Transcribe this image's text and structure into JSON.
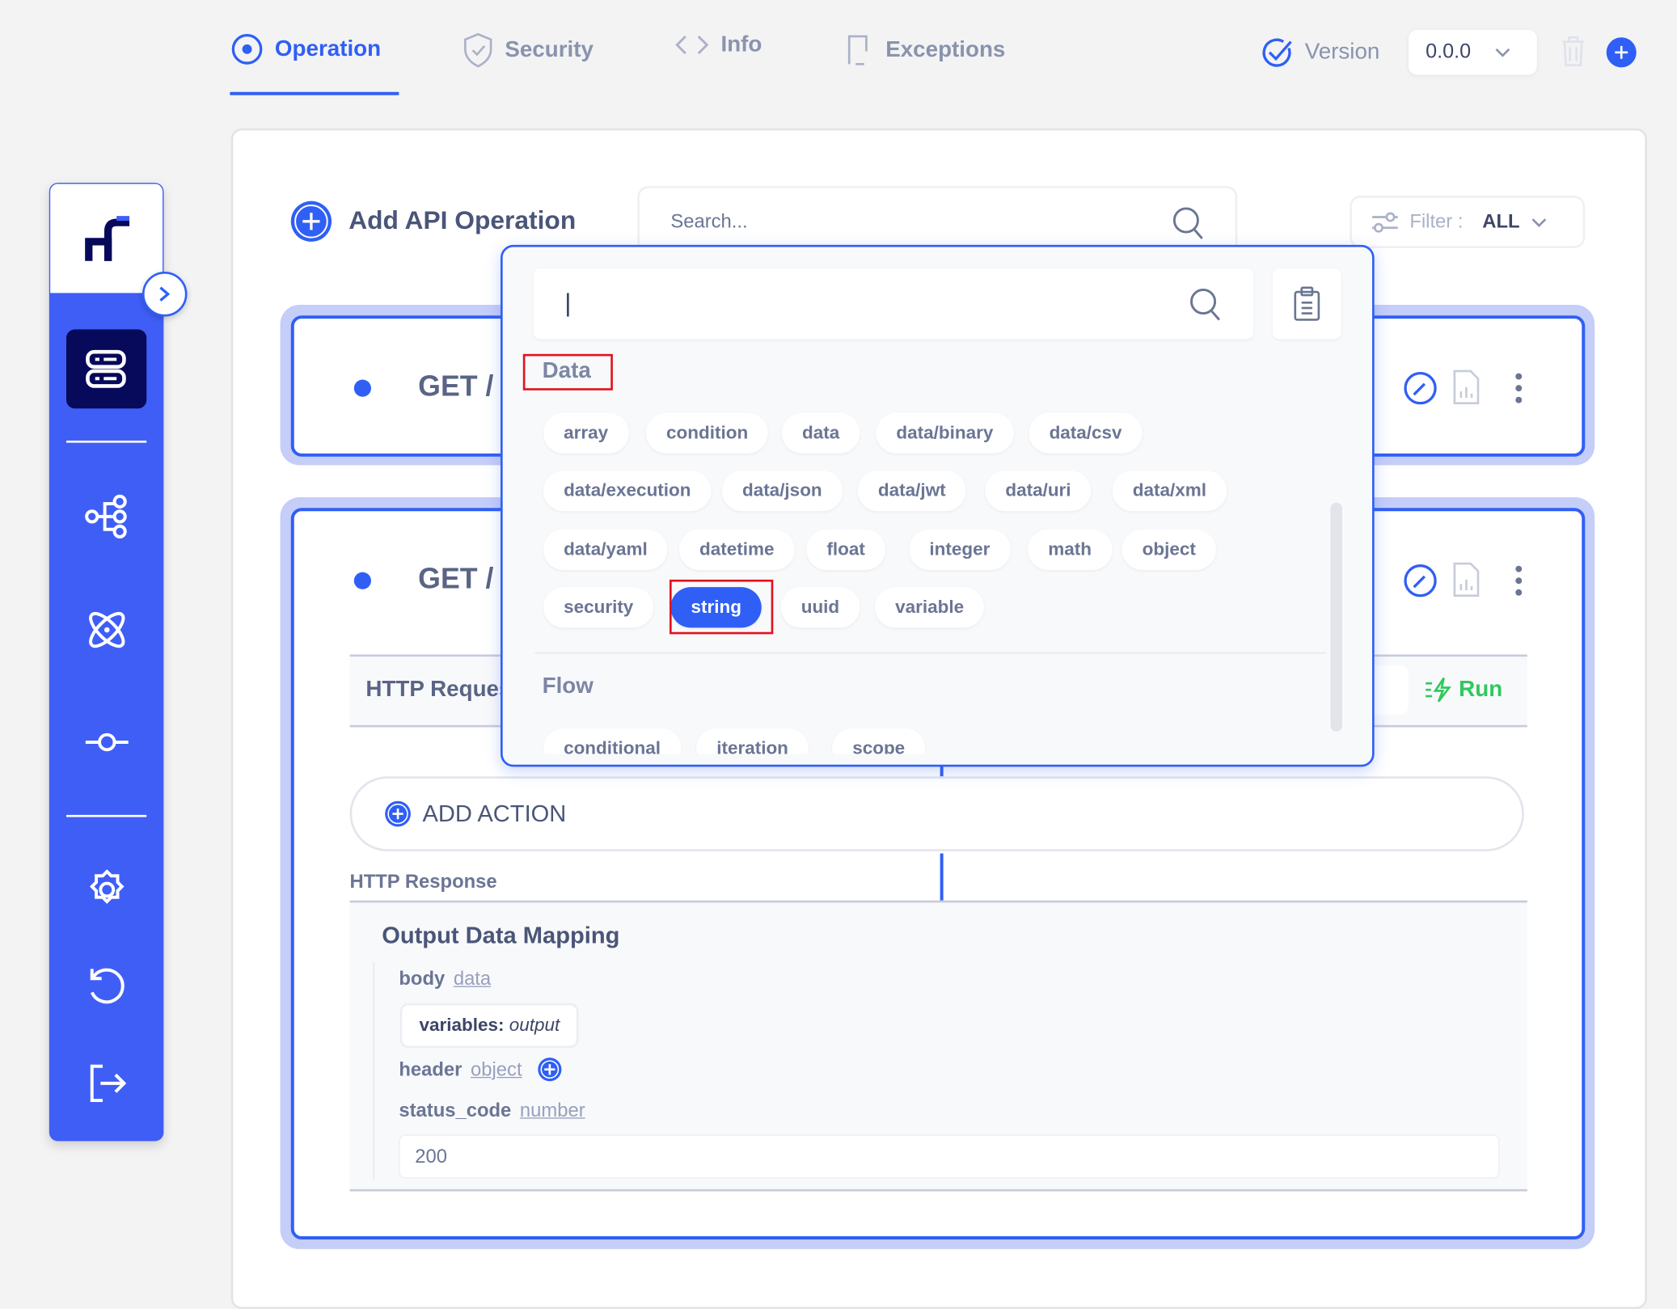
{
  "tabs": [
    {
      "label": "Operation",
      "icon": "radio-target-icon",
      "active": true
    },
    {
      "label": "Security",
      "icon": "shield-check-icon"
    },
    {
      "label": "Info",
      "icon": "code-brackets-icon"
    },
    {
      "label": "Exceptions",
      "icon": "document-exception-icon"
    }
  ],
  "version": {
    "label": "Version",
    "value": "0.0.0"
  },
  "toolbar": {
    "add_operation": "Add API Operation",
    "search_placeholder": "Search...",
    "filter_label": "Filter :",
    "filter_value": "ALL"
  },
  "operations": [
    {
      "method": "GET",
      "path": "/"
    },
    {
      "method": "GET",
      "path": "/"
    }
  ],
  "operation_detail": {
    "http_request": "HTTP Request",
    "run": "Run",
    "add_action": "ADD ACTION",
    "http_response": "HTTP Response",
    "output_title": "Output Data Mapping",
    "body_label": "body",
    "body_type": "data",
    "variables_key": "variables:",
    "variables_value": "output",
    "header_label": "header",
    "header_type": "object",
    "status_label": "status_code",
    "status_type": "number",
    "status_value": "200"
  },
  "popup": {
    "search_value": "",
    "data_title": "Data",
    "data_items": [
      "array",
      "condition",
      "data",
      "data/binary",
      "data/csv",
      "data/execution",
      "data/json",
      "data/jwt",
      "data/uri",
      "data/xml",
      "data/yaml",
      "datetime",
      "float",
      "integer",
      "math",
      "object",
      "security",
      "string",
      "uuid",
      "variable"
    ],
    "selected": "string",
    "flow_title": "Flow",
    "flow_items": [
      "conditional",
      "iteration",
      "scope"
    ]
  },
  "colors": {
    "accent": "#2f5ff5",
    "sidebar": "#3f5ef6",
    "sidebar_active": "#07095a",
    "run": "#2ec95c",
    "highlight": "#e0141e"
  }
}
